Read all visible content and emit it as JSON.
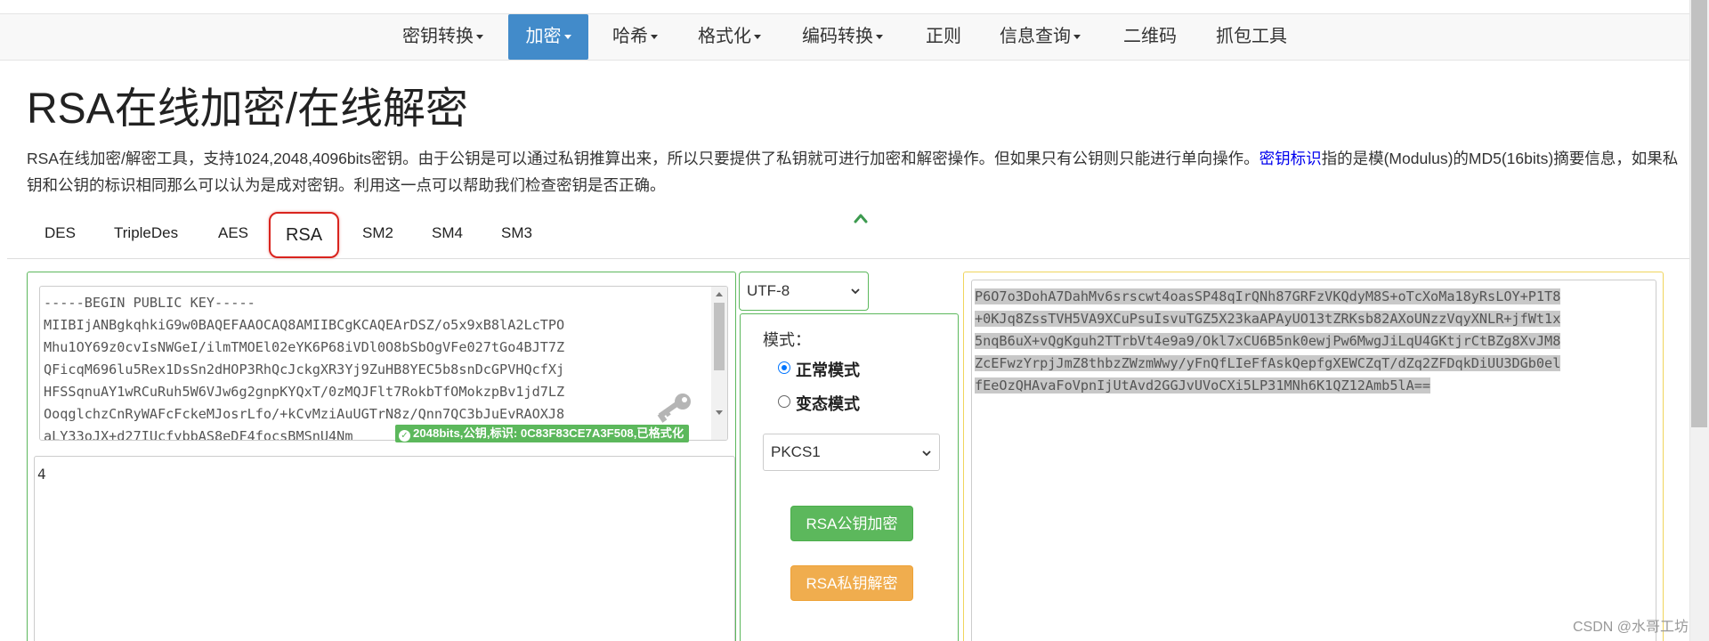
{
  "nav": {
    "items": [
      {
        "label": "密钥转换",
        "dropdown": true
      },
      {
        "label": "加密",
        "dropdown": true,
        "active": true
      },
      {
        "label": "哈希",
        "dropdown": true
      },
      {
        "label": "格式化",
        "dropdown": true
      },
      {
        "label": "编码转换",
        "dropdown": true
      },
      {
        "label": "正则",
        "dropdown": false
      },
      {
        "label": "信息查询",
        "dropdown": true
      },
      {
        "label": "二维码",
        "dropdown": false
      },
      {
        "label": "抓包工具",
        "dropdown": false
      }
    ]
  },
  "page": {
    "title": "RSA在线加密/在线解密",
    "desc_part1": "RSA在线加密/解密工具，支持1024,2048,4096bits密钥。由于公钥是可以通过私钥推算出来，所以只要提供了私钥就可进行加密和解密操作。但如果只有公钥则只能进行单向操作。",
    "desc_link": "密钥标识",
    "desc_part2": "指的是模(Modulus)的MD5(16bits)摘要信息，如果私钥和公钥的标识相同那么可以认为是成对密钥。利用这一点可以帮助我们检查密钥是否正确。"
  },
  "tabs": [
    "DES",
    "TripleDes",
    "AES",
    "RSA",
    "SM2",
    "SM4",
    "SM3"
  ],
  "active_tab": "RSA",
  "left": {
    "key_lines": [
      "-----BEGIN PUBLIC KEY-----",
      "MIIBIjANBgkqhkiG9w0BAQEFAAOCAQ8AMIIBCgKCAQEArDSZ/o5x9xB8lA2LcTPO",
      "Mhu1OY69z0cvIsNWGeI/ilmTMOEl02eYK6P68iVDl0O8bSbOgVFe027tGo4BJT7Z",
      "QFicqM696lu5Rex1DsSn2dHOP3RhQcJckgXR3Yj9ZuHB8YEC5b8snDcGPVHQcfXj",
      "HFSSqnuAY1wRCuRuh5W6VJw6g2gnpKYQxT/0zMQJFlt7RokbTfOMokzpBv1jd7LZ",
      "OoqglchzCnRyWAFcFckeMJosrLfo/+kCvMziAuUGTrN8z/Qnn7QC3bJuEvRAOXJ8",
      "aLY33oJX+d27IUcfybbAS8eDF4focsBMSnU4Nm"
    ],
    "badge": "2048bits,公钥,标识: 0C83F83CE7A3F508,已格式化",
    "plaintext": "4"
  },
  "middle": {
    "charset": "UTF-8",
    "mode_label": "模式：",
    "mode_normal": "正常模式",
    "mode_variant": "变态模式",
    "padding": "PKCS1",
    "encrypt_button": "RSA公钥加密",
    "decrypt_button": "RSA私钥解密"
  },
  "right": {
    "cipher_lines": [
      "P6O7o3DohA7DahMv6srscwt4oasSP48qIrQNh87GRFzVKQdyM8S+oTcXoMa18yRsLOY+P1T8",
      "+0KJq8ZssTVH5VA9XCuPsuIsvuTGZ5X23kaAPAyUO13tZRKsb82AXoUNzzVqyXNLR+jfWt1x",
      "5nqB6uX+vQgKguh2TTrbVt4e9a9/Okl7xCU6B5nk0ewjPw6MwgJiLqU4GKtjrCtBZg8XvJM8",
      "ZcEFwzYrpjJmZ8thbzZWzmWwy/yFnQfLIeFfAskQepfgXEWCZqT/dZq2ZFDqkDiUU3DGb0el",
      "fEeOzQHAvaFoVpnIjUtAvd2GGJvUVoCXi5LP31MNh6K1QZ12Amb5lA=="
    ]
  },
  "watermark": "CSDN @水哥工坊",
  "colors": {
    "nav_active": "#428bca",
    "left_border": "#5cb85c",
    "right_border": "#f0d55c",
    "encrypt_button": "#5cb85c",
    "decrypt_button": "#f0ad4e",
    "badge": "#5cb85c",
    "rsa_tab_highlight": "#d9241e"
  }
}
